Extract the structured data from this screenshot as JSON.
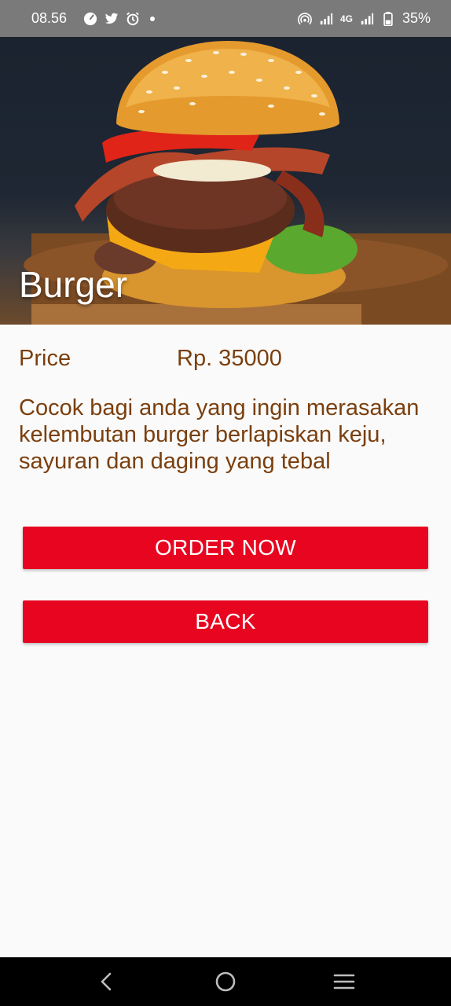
{
  "status_bar": {
    "time": "08.56",
    "network_label": "4G",
    "battery": "35%",
    "icons": [
      "speedometer-icon",
      "twitter-icon",
      "alarm-icon",
      "dot-icon",
      "hotspot-icon",
      "signal-icon",
      "signal-4g-icon",
      "battery-icon"
    ]
  },
  "hero": {
    "title": "Burger",
    "image": "burger-photo"
  },
  "product": {
    "price_label": "Price",
    "price_value": "Rp. 35000",
    "description": "Cocok bagi anda yang ingin merasakan kelembutan burger berlapiskan keju, sayuran dan daging yang tebal"
  },
  "actions": {
    "order_label": "ORDER NOW",
    "back_label": "BACK"
  },
  "colors": {
    "status_bar": "#7a7a7a",
    "text_brown": "#7a3f0e",
    "button_red": "#e8051f",
    "background": "#fafafa",
    "nav_bar": "#000000"
  },
  "nav": {
    "icons": [
      "back-nav-icon",
      "home-nav-icon",
      "recents-nav-icon"
    ]
  }
}
